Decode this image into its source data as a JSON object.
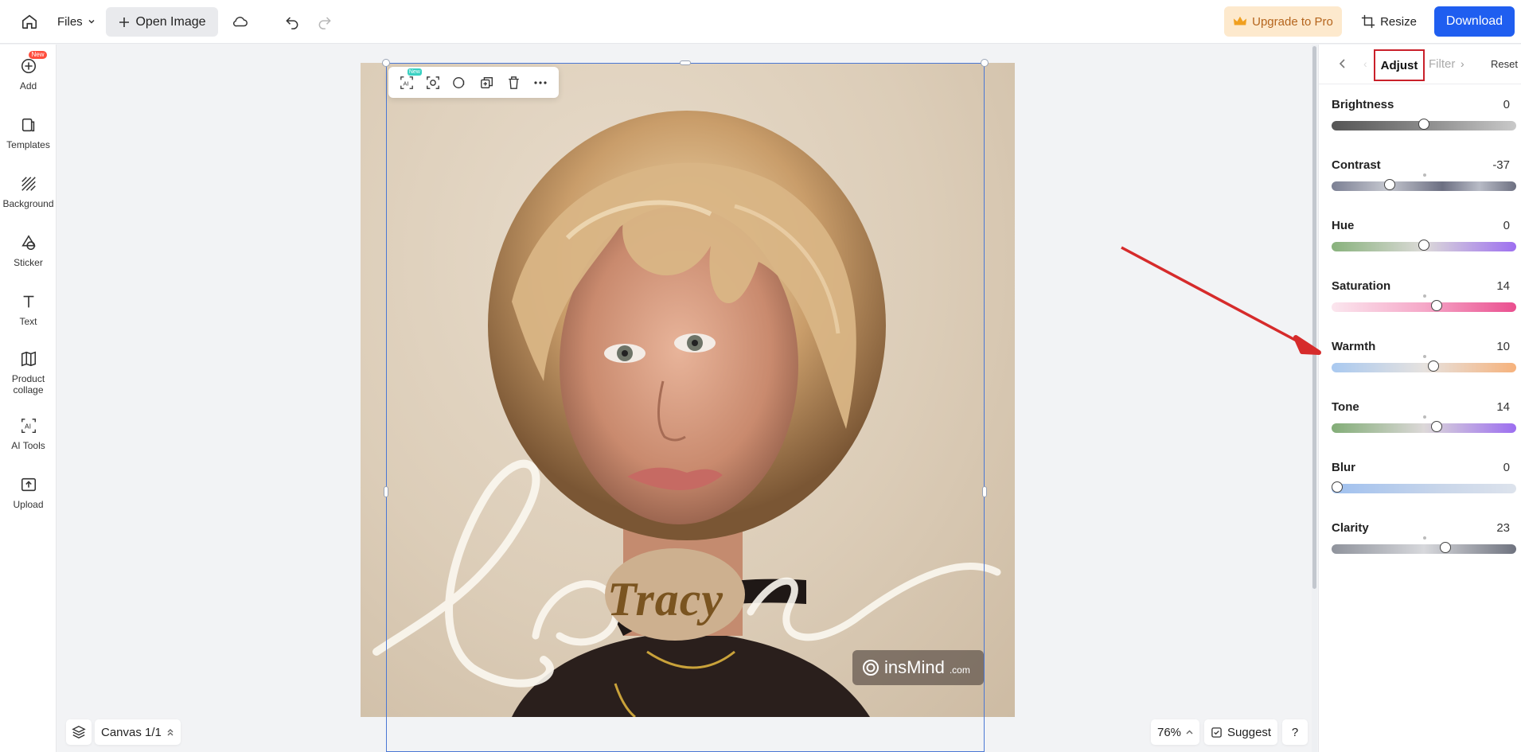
{
  "topbar": {
    "files_label": "Files",
    "open_image_label": "Open Image",
    "upgrade_label": "Upgrade to Pro",
    "resize_label": "Resize",
    "download_label": "Download"
  },
  "sidebar": {
    "items": [
      {
        "label": "Add",
        "icon": "add-icon",
        "badge": "New"
      },
      {
        "label": "Templates",
        "icon": "templates-icon"
      },
      {
        "label": "Background",
        "icon": "background-icon"
      },
      {
        "label": "Sticker",
        "icon": "sticker-icon"
      },
      {
        "label": "Text",
        "icon": "text-icon"
      },
      {
        "label": "Product collage",
        "icon": "collage-icon"
      },
      {
        "label": "AI Tools",
        "icon": "ai-tools-icon"
      },
      {
        "label": "Upload",
        "icon": "upload-icon"
      }
    ]
  },
  "canvas": {
    "artwork_text": "Tracy",
    "script_text": "Love",
    "watermark_brand": "insMind",
    "watermark_suffix": ".com",
    "mini_toolbar_badge": "New",
    "canvas_label": "Canvas 1/1",
    "zoom": "76%",
    "suggest_label": "Suggest",
    "help_label": "?"
  },
  "panel": {
    "active_tab": "Adjust",
    "next_tab": "Filter",
    "reset_label": "Reset",
    "sliders": [
      {
        "label": "Brightness",
        "value": "0",
        "min": -100,
        "max": 100,
        "level": 0
      },
      {
        "label": "Contrast",
        "value": "-37",
        "min": -100,
        "max": 100,
        "level": -37
      },
      {
        "label": "Hue",
        "value": "0",
        "min": -100,
        "max": 100,
        "level": 0
      },
      {
        "label": "Saturation",
        "value": "14",
        "min": -100,
        "max": 100,
        "level": 14
      },
      {
        "label": "Warmth",
        "value": "10",
        "min": -100,
        "max": 100,
        "level": 10
      },
      {
        "label": "Tone",
        "value": "14",
        "min": -100,
        "max": 100,
        "level": 14
      },
      {
        "label": "Blur",
        "value": "0",
        "min": 0,
        "max": 100,
        "level": 0
      },
      {
        "label": "Clarity",
        "value": "23",
        "min": -100,
        "max": 100,
        "level": 23
      }
    ]
  },
  "colors": {
    "accent": "#1f5ef0",
    "highlight_box": "#c9202a",
    "annotation_arrow": "#d62b2b",
    "upgrade_bg": "#fde9cd"
  }
}
